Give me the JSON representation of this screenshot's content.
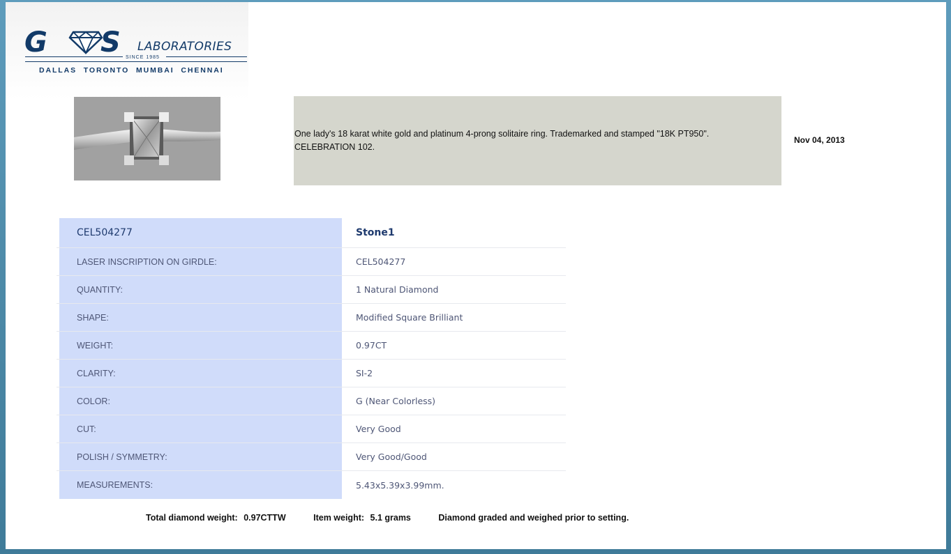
{
  "header": {
    "logo": {
      "letters_left": "G",
      "letters_right": "S",
      "name": "LABORATORIES",
      "since": "SINCE 1985",
      "cities": "DALLAS TORONTO MUMBAI CHENNAI"
    },
    "brand_color": "#123a68"
  },
  "item": {
    "description": "One lady's 18 karat white gold and platinum 4-prong solitaire ring. Trademarked and stamped \"18K PT950\".      CELEBRATION 102.",
    "date": "Nov 04, 2013"
  },
  "grading": {
    "header": {
      "label": "CEL504277",
      "value": "Stone1"
    },
    "rows": [
      {
        "label": "LASER INSCRIPTION ON GIRDLE:",
        "value": "CEL504277"
      },
      {
        "label": "QUANTITY:",
        "value": "1 Natural Diamond"
      },
      {
        "label": "SHAPE:",
        "value": "Modified Square Brilliant"
      },
      {
        "label": "WEIGHT:",
        "value": "0.97CT"
      },
      {
        "label": "CLARITY:",
        "value": "SI-2"
      },
      {
        "label": "COLOR:",
        "value": "G (Near Colorless)"
      },
      {
        "label": "CUT:",
        "value": "Very Good"
      },
      {
        "label": "POLISH / SYMMETRY:",
        "value": "Very Good/Good"
      },
      {
        "label": "MEASUREMENTS:",
        "value": "5.43x5.39x3.99mm."
      }
    ]
  },
  "footer": {
    "total_label": "Total diamond weight:",
    "total_value": "0.97CTTW",
    "item_label": "Item weight:",
    "item_value": "5.1 grams",
    "note": "Diamond graded and weighed prior to setting."
  }
}
